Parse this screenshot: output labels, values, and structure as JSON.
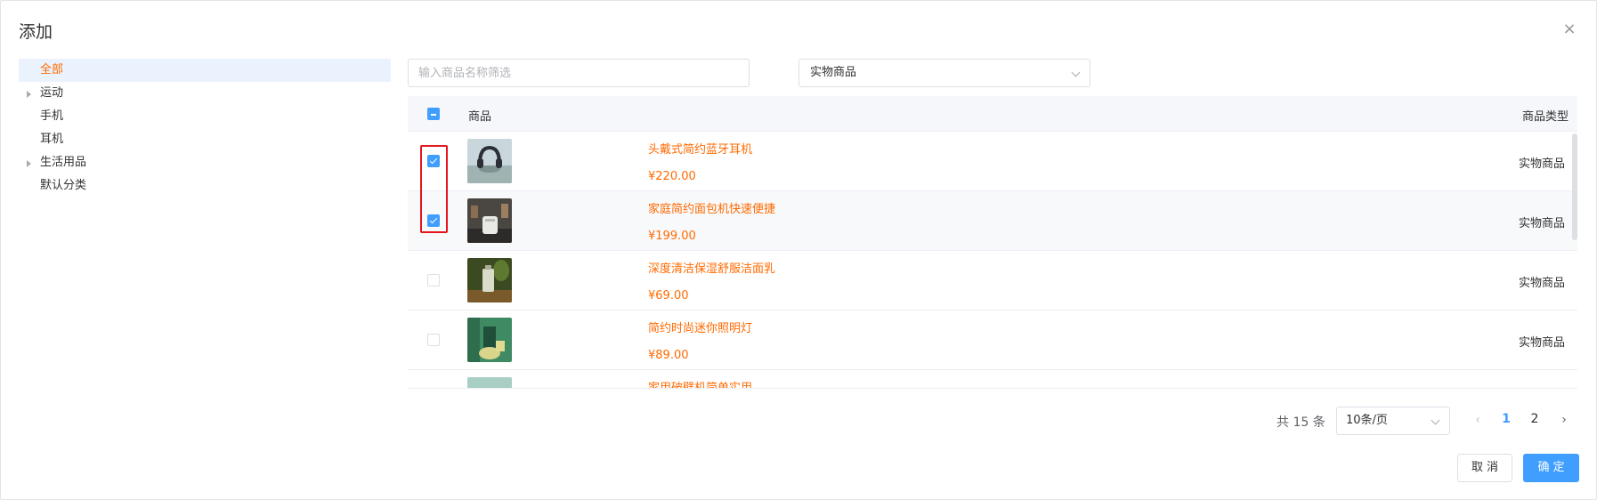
{
  "dialog": {
    "title": "添加",
    "close_icon": "×"
  },
  "tree": [
    {
      "label": "全部",
      "active": true,
      "expandable": false
    },
    {
      "label": "运动",
      "active": false,
      "expandable": true
    },
    {
      "label": "手机",
      "active": false,
      "expandable": false
    },
    {
      "label": "耳机",
      "active": false,
      "expandable": false
    },
    {
      "label": "生活用品",
      "active": false,
      "expandable": true
    },
    {
      "label": "默认分类",
      "active": false,
      "expandable": false
    }
  ],
  "filters": {
    "search_placeholder": "输入商品名称筛选",
    "type_select": "实物商品"
  },
  "table": {
    "col_product": "商品",
    "col_type": "商品类型",
    "rows": [
      {
        "name": "头戴式简约蓝牙耳机",
        "price": "¥220.00",
        "type": "实物商品",
        "checked": true
      },
      {
        "name": "家庭简约面包机快速便捷",
        "price": "¥199.00",
        "type": "实物商品",
        "checked": true
      },
      {
        "name": "深度清洁保湿舒服洁面乳",
        "price": "¥69.00",
        "type": "实物商品",
        "checked": false
      },
      {
        "name": "简约时尚迷你照明灯",
        "price": "¥89.00",
        "type": "实物商品",
        "checked": false
      },
      {
        "name": "家用破壁机简单实用",
        "price": "",
        "type": "",
        "checked": false
      }
    ]
  },
  "pagination": {
    "total": "共 15 条",
    "page_size": "10条/页",
    "prev_icon": "‹",
    "next_icon": "›",
    "pages": [
      "1",
      "2"
    ],
    "current": "1"
  },
  "footer": {
    "cancel": "取消",
    "ok": "确定"
  },
  "colors": {
    "accent": "#409eff",
    "highlight": "#ff6a00",
    "annotation": "#e4151d"
  }
}
